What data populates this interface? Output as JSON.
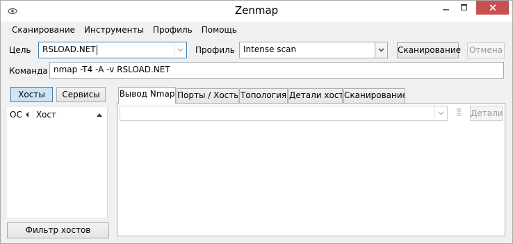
{
  "window": {
    "title": "Zenmap"
  },
  "menu": [
    {
      "label": "Сканирование"
    },
    {
      "label": "Инструменты"
    },
    {
      "label": "Профиль"
    },
    {
      "label": "Помощь"
    }
  ],
  "toolbar": {
    "target_label": "Цель",
    "target_value": "RSLOAD.NET",
    "profile_label": "Профиль",
    "profile_value": "Intense scan",
    "scan_button": "Сканирование",
    "cancel_button": "Отмена",
    "command_label": "Команда",
    "command_value": "nmap -T4 -A -v RSLOAD.NET"
  },
  "left_panel": {
    "hosts_button": "Хосты",
    "services_button": "Сервисы",
    "columns": {
      "os": "ОС",
      "host": "Хост"
    },
    "filter_button": "Фильтр хостов"
  },
  "tabs": [
    {
      "label": "Вывод Nmap",
      "selected": true
    },
    {
      "label": "Порты / Хосты",
      "selected": false
    },
    {
      "label": "Топология",
      "selected": false
    },
    {
      "label": "Детали хоста",
      "selected": false
    },
    {
      "label": "Сканирование",
      "selected": false
    }
  ],
  "nmap_output": {
    "host_select_value": "",
    "details_button": "Детали"
  },
  "icons": {
    "app": "zenmap-eye-icon",
    "minimize": "minimize-icon",
    "maximize": "maximize-icon",
    "close": "close-icon"
  },
  "colors": {
    "close_button": "#c75050",
    "window_background": "#f0f0f0",
    "active_toggle": "#cde6f7"
  }
}
